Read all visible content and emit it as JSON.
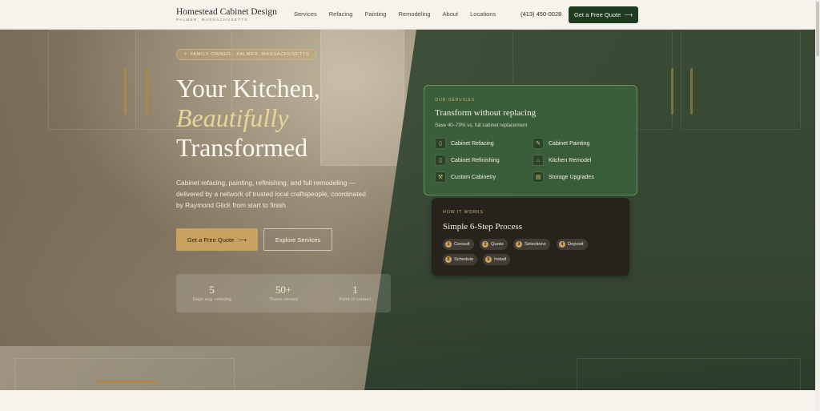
{
  "header": {
    "brand_name": "Homestead Cabinet Design",
    "brand_location": "PALMER, MASSACHUSETTS",
    "nav": [
      "Services",
      "Refacing",
      "Painting",
      "Remodeling",
      "About",
      "Locations"
    ],
    "phone": "(413) 450-0028",
    "cta_label": "Get a Free Quote",
    "cta_arrow": "⟶"
  },
  "hero": {
    "badge": "FAMILY-OWNED · PALMER, MASSACHUSETTS",
    "badge_icon": "✧",
    "headline_1": "Your Kitchen,",
    "headline_2": "Beautifully",
    "headline_3": "Transformed",
    "lede": "Cabinet refacing, painting, refinishing, and full remodeling — delivered by a network of trusted local craftspeople, coordinated by Raymond Glick from start to finish.",
    "primary_cta": "Get a Free Quote",
    "primary_arrow": "⟶",
    "secondary_cta": "Explore Services",
    "stats": [
      {
        "value": "5",
        "label": "Days avg. refacing"
      },
      {
        "value": "50+",
        "label": "Towns served"
      },
      {
        "value": "1",
        "label": "Point of contact"
      }
    ]
  },
  "services_card": {
    "eyebrow": "OUR SERVICES",
    "title": "Transform without replacing",
    "subtitle": "Save 40–70% vs. full cabinet replacement",
    "items": [
      {
        "label": "Cabinet Refacing",
        "icon": "cabinet-icon",
        "glyph": "▯"
      },
      {
        "label": "Cabinet Painting",
        "icon": "brush-icon",
        "glyph": "✎"
      },
      {
        "label": "Cabinet Refinishing",
        "icon": "door-icon",
        "glyph": "▯"
      },
      {
        "label": "Kitchen Remodel",
        "icon": "home-icon",
        "glyph": "⌂"
      },
      {
        "label": "Custom Cabinetry",
        "icon": "hammer-icon",
        "glyph": "⚒"
      },
      {
        "label": "Storage Upgrades",
        "icon": "shelves-icon",
        "glyph": "▤"
      }
    ]
  },
  "process_card": {
    "eyebrow": "HOW IT WORKS",
    "title": "Simple 6-Step Process",
    "steps": [
      {
        "num": "1",
        "label": "Consult"
      },
      {
        "num": "2",
        "label": "Quote"
      },
      {
        "num": "3",
        "label": "Selections"
      },
      {
        "num": "4",
        "label": "Deposit"
      },
      {
        "num": "5",
        "label": "Schedule"
      },
      {
        "num": "6",
        "label": "Install"
      }
    ]
  },
  "colors": {
    "brand_green": "#1f3b22",
    "accent_gold": "#c9a161",
    "headline_accent": "#e9d49a",
    "card_green": "#3a603a"
  }
}
